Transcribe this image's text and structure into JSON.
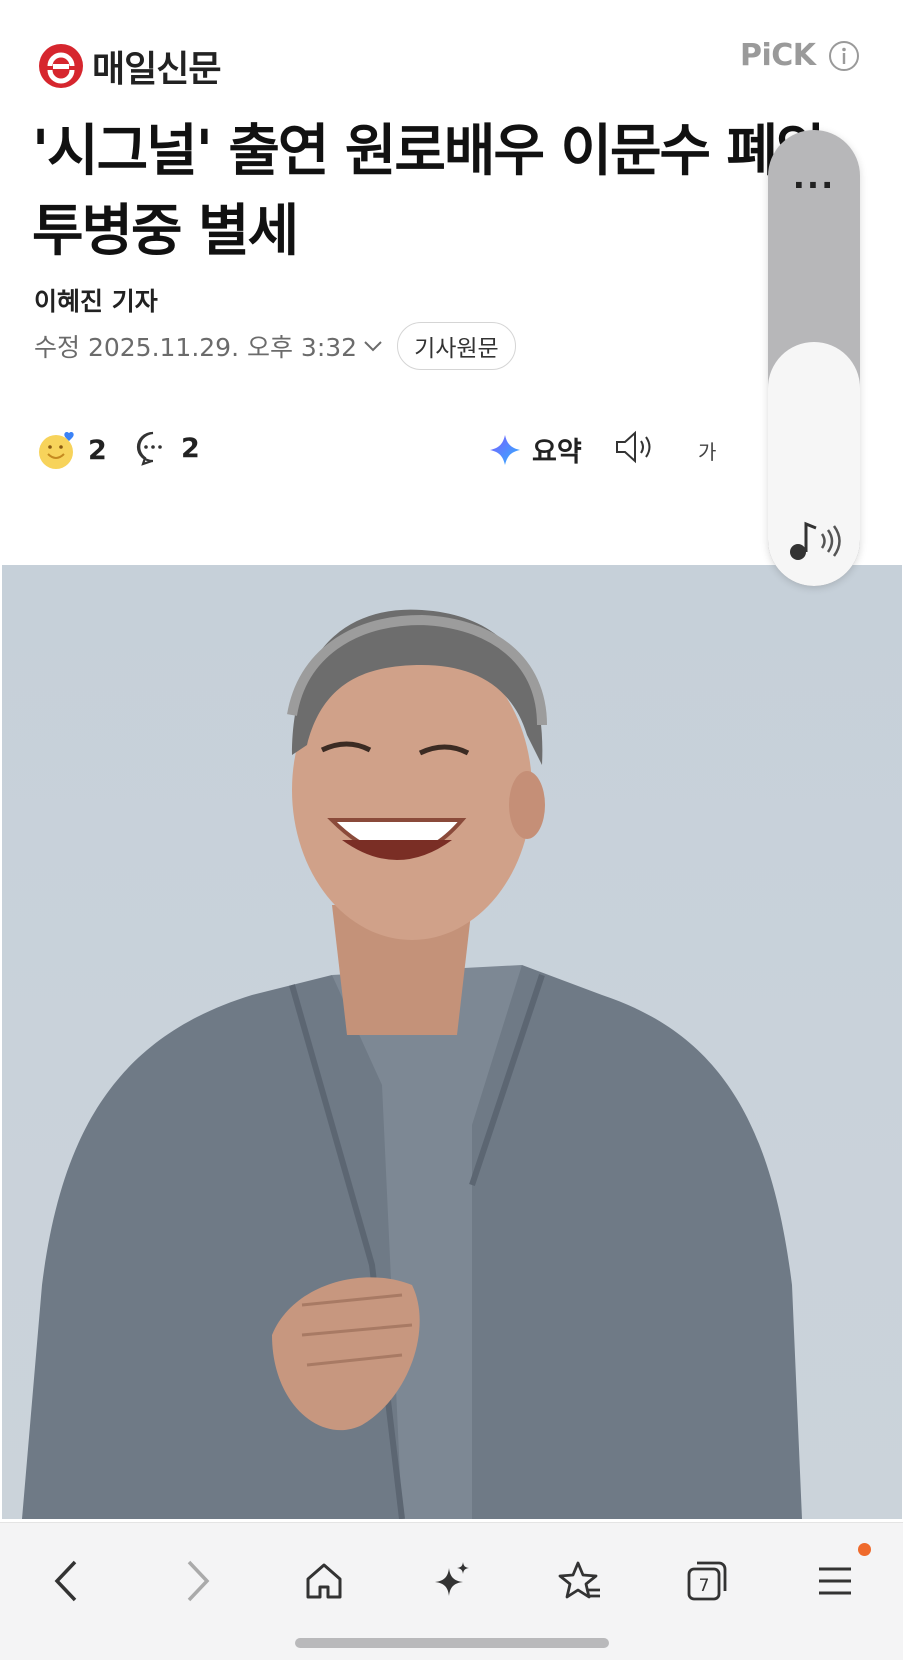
{
  "header": {
    "publisher": "매일신문",
    "pick_label": "PiCK"
  },
  "article": {
    "title": "'시그널' 출연 원로배우 이문수 폐암 투병중 별세",
    "author": "이혜진 기자",
    "modified": "수정 2025.11.29. 오후 3:32",
    "source_button": "기사원문"
  },
  "actions": {
    "reaction_count": "2",
    "comment_count": "2",
    "summary_label": "요약",
    "font_size_label": "가"
  },
  "scroller": {
    "dots": "..."
  },
  "browser_bar": {
    "tab_count": "7"
  },
  "colors": {
    "brand_red": "#d6262e",
    "pick_gray": "#9a9a9a",
    "notification_dot": "#ef6a2c"
  }
}
